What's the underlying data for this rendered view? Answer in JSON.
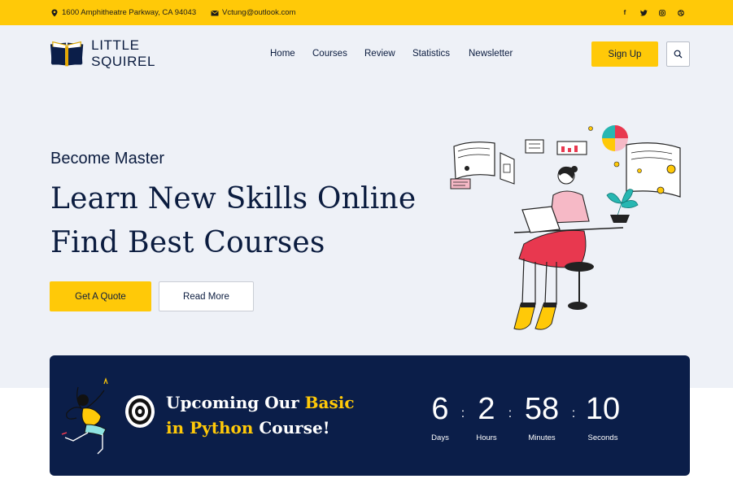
{
  "topbar": {
    "address": "1600 Amphitheatre Parkway, CA 94043",
    "email": "Vctung@outlook.com",
    "social": [
      {
        "icon": "facebook-icon",
        "glyph": "f"
      },
      {
        "icon": "twitter-icon",
        "glyph": "t"
      },
      {
        "icon": "instagram-icon",
        "glyph": "◎"
      },
      {
        "icon": "dribbble-icon",
        "glyph": "◉"
      }
    ]
  },
  "header": {
    "logo_text": "LITTLE SQUIREL",
    "nav": [
      "Home",
      "Courses",
      "Review",
      "Statistics",
      "Newsletter"
    ],
    "signup_label": "Sign Up"
  },
  "hero": {
    "kicker": "Become Master",
    "headline_line1": "Learn New Skills Online",
    "headline_line2": "Find Best Courses",
    "quote_label": "Get A Quote",
    "read_label": "Read More"
  },
  "banner": {
    "text_part1": "Upcoming Our ",
    "text_highlight1": "Basic",
    "text_highlight2": "in Python",
    "text_part2": " Course!",
    "countdown": [
      {
        "value": "6",
        "label": "Days"
      },
      {
        "value": "2",
        "label": "Hours"
      },
      {
        "value": "58",
        "label": "Minutes"
      },
      {
        "value": "10",
        "label": "Seconds"
      }
    ],
    "separator": ":"
  },
  "colors": {
    "accent": "#ffc908",
    "navy": "#0b1e49",
    "hero_bg": "#eef1f7"
  }
}
